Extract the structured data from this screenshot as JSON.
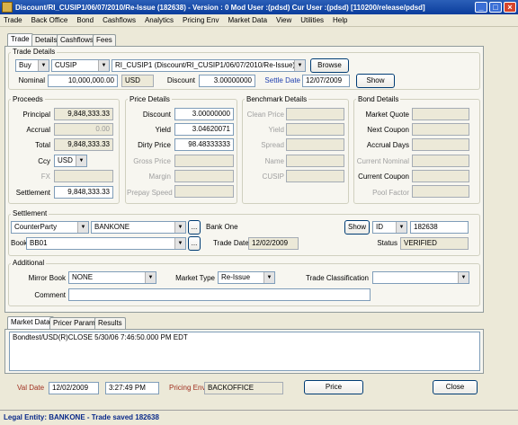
{
  "window": {
    "title": "Discount/RI_CUSIP1/06/07/2010/Re-Issue (182638) - Version : 0 Mod User :(pdsd) Cur User :(pdsd) [110200/release/pdsd]"
  },
  "menu": [
    "Trade",
    "Back Office",
    "Bond",
    "Cashflows",
    "Analytics",
    "Pricing Env",
    "Market Data",
    "View",
    "Utilities",
    "Help"
  ],
  "tabs": [
    "Trade",
    "Details",
    "Cashflows",
    "Fees"
  ],
  "trade_details": {
    "title": "Trade Details",
    "direction": "Buy",
    "id_type": "CUSIP",
    "product": "RI_CUSIP1 (Discount/RI_CUSIP1/06/07/2010/Re-Issue)",
    "browse_label": "Browse",
    "nominal_label": "Nominal",
    "nominal": "10,000,000.00",
    "currency": "USD",
    "discount_label": "Discount",
    "discount": "3.00000000",
    "settle_date_label": "Settle Date",
    "settle_date": "12/07/2009",
    "show_label": "Show"
  },
  "proceeds": {
    "title": "Proceeds",
    "principal_label": "Principal",
    "principal": "9,848,333.33",
    "accrual_label": "Accrual",
    "accrual": "0.00",
    "total_label": "Total",
    "total": "9,848,333.33",
    "ccy_label": "Ccy",
    "ccy": "USD",
    "fx_label": "FX",
    "fx": "",
    "settlement_label": "Settlement",
    "settlement": "9,848,333.33"
  },
  "price_details": {
    "title": "Price Details",
    "discount_label": "Discount",
    "discount": "3.00000000",
    "yield_label": "Yield",
    "yield": "3.04620071",
    "dirty_price_label": "Dirty Price",
    "dirty_price": "98.48333333",
    "gross_price_label": "Gross Price",
    "margin_label": "Margin",
    "prepay_speed_label": "Prepay Speed"
  },
  "benchmark_details": {
    "title": "Benchmark Details",
    "clean_price_label": "Clean Price",
    "yield_label": "Yield",
    "spread_label": "Spread",
    "name_label": "Name",
    "cusip_label": "CUSIP"
  },
  "bond_details": {
    "title": "Bond Details",
    "market_quote_label": "Market Quote",
    "next_coupon_label": "Next Coupon",
    "accrual_days_label": "Accrual Days",
    "current_nominal_label": "Current Nominal",
    "current_coupon_label": "Current Coupon",
    "pool_factor_label": "Pool Factor"
  },
  "settlement": {
    "title": "Settlement",
    "role": "CounterParty",
    "counterparty_code": "BANKONE",
    "counterparty_name": "Bank One",
    "ellipsis": "...",
    "show_label": "Show",
    "id_type": "ID",
    "id_value": "182638",
    "book_label": "Book",
    "book": "BB01",
    "trade_date_label": "Trade Date",
    "trade_date": "12/02/2009",
    "status_label": "Status",
    "status": "VERIFIED"
  },
  "additional": {
    "title": "Additional",
    "mirror_book_label": "Mirror Book",
    "mirror_book": "NONE",
    "market_type_label": "Market Type",
    "market_type": "Re-Issue",
    "trade_classification_label": "Trade Classification",
    "trade_classification": "",
    "comment_label": "Comment",
    "comment": ""
  },
  "bottom_tabs": [
    "Market Data",
    "Pricer Params",
    "Results"
  ],
  "market_data_line": "Bondtest/USD(R)CLOSE 5/30/06 7:46:50.000 PM EDT",
  "footer": {
    "val_date_label": "Val Date",
    "val_date": "12/02/2009",
    "val_time": "3:27:49 PM",
    "pricing_env_label": "Pricing Env",
    "pricing_env": "BACKOFFICE",
    "price_label": "Price",
    "close_label": "Close"
  },
  "status_bar": "Legal Entity: BANKONE - Trade saved 182638"
}
